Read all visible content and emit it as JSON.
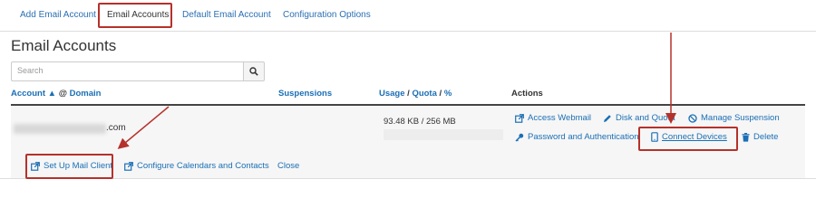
{
  "tabs": [
    {
      "label": "Add Email Account"
    },
    {
      "label": "Email Accounts",
      "active": true
    },
    {
      "label": "Default Email Account"
    },
    {
      "label": "Configuration Options"
    }
  ],
  "page_title": "Email Accounts",
  "search": {
    "placeholder": "Search"
  },
  "table": {
    "headers": {
      "account": "Account",
      "sort_arrow": "▲",
      "at": "@",
      "domain": "Domain",
      "suspensions": "Suspensions",
      "usage": "Usage",
      "slash1": "/",
      "quota": "Quota",
      "slash2": "/",
      "percent": "%",
      "actions": "Actions"
    },
    "row": {
      "domain_suffix": ".com",
      "usage_text": "93.48 KB / 256 MB",
      "usage_fraction": 0.0004,
      "actions": {
        "access_webmail": "Access Webmail",
        "disk_and_quota": "Disk and Quota",
        "manage_suspension": "Manage Suspension",
        "password_auth": "Password and Authentication",
        "connect_devices": "Connect Devices",
        "delete": "Delete"
      }
    },
    "expanded": {
      "setup_mail_client": "Set Up Mail Client",
      "configure_calendars": "Configure Calendars and Contacts",
      "close": "Close"
    }
  },
  "colors": {
    "link": "#1a6fb5",
    "highlight": "#b5312b",
    "row_bg": "#f6f6f6"
  }
}
